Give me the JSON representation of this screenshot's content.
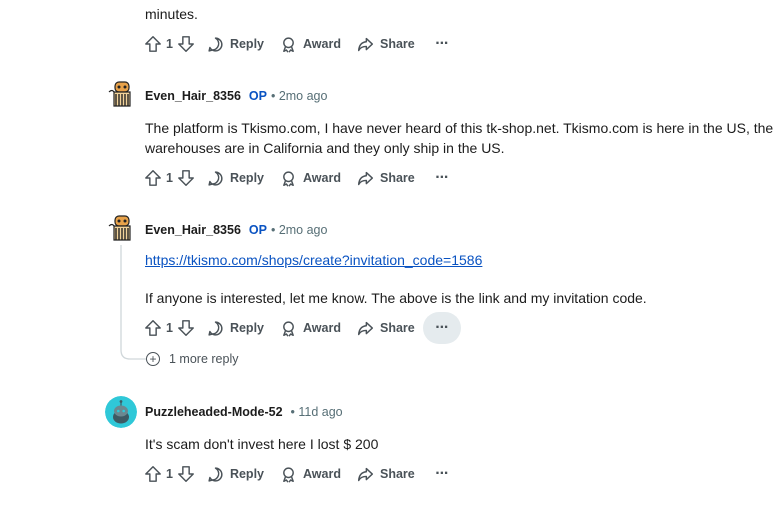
{
  "top_comment": {
    "body_tail": "minutes.",
    "vote_count": "1",
    "reply_label": "Reply",
    "award_label": "Award",
    "share_label": "Share",
    "more_label": "···"
  },
  "comment1": {
    "username": "Even_Hair_8356",
    "op_label": "OP",
    "meta": "• 2mo ago",
    "body_line1": "The platform is Tkismo.com, I have never heard of this tk-shop.net. Tkismo.com is here in the US, their",
    "body_line2": "warehouses are in California and they only ship in the US.",
    "vote_count": "1",
    "reply_label": "Reply",
    "award_label": "Award",
    "share_label": "Share",
    "more_label": "···"
  },
  "comment2": {
    "username": "Even_Hair_8356",
    "op_label": "OP",
    "meta": "• 2mo ago",
    "link_text": "https://tkismo.com/shops/create?invitation_code=1586",
    "body": "If anyone is interested, let me know. The above is the link and my invitation code.",
    "vote_count": "1",
    "reply_label": "Reply",
    "award_label": "Award",
    "share_label": "Share",
    "more_label": "···",
    "more_replies": "1 more reply"
  },
  "comment3": {
    "username": "Puzzleheaded-Mode-52",
    "meta": "• 11d ago",
    "body": "It's scam don't invest here I lost $ 200",
    "vote_count": "1",
    "reply_label": "Reply",
    "award_label": "Award",
    "share_label": "Share",
    "more_label": "···"
  },
  "colors": {
    "op_blue": "#0a53c2",
    "action_gray": "#4a5258",
    "hover_bg": "#e5ebee",
    "thread_line": "#d0d7da",
    "avatar_teal": "#2fc8d8"
  },
  "icons": [
    "upvote-icon",
    "downvote-icon",
    "comment-icon",
    "award-icon",
    "share-icon",
    "overflow-icon",
    "expand-plus-icon"
  ]
}
